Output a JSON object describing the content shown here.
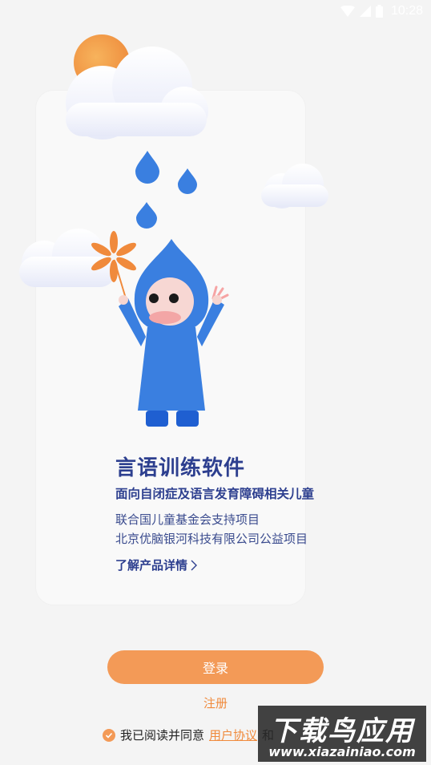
{
  "status_bar": {
    "time": "10:28"
  },
  "card": {
    "title": "言语训练软件",
    "subtitle": "面向自闭症及语言发育障碍相关儿童",
    "support_line1": "联合国儿童基金会支持项目",
    "support_line2": "北京优脑银河科技有限公司公益项目",
    "detail_link": "了解产品详情",
    "detail_icon": "chevron-right-icon"
  },
  "actions": {
    "login_label": "登录",
    "register_label": "注册"
  },
  "agreement": {
    "checked": true,
    "prefix": "我已阅读并同意",
    "user_agreement": "用户协议",
    "suffix": "和"
  },
  "watermark": {
    "title": "下载鸟应用",
    "url": "www.xiazainiao.com"
  },
  "colors": {
    "accent": "#f39a57",
    "title_blue": "#2d3f8f",
    "raincoat_blue": "#3a7fe0"
  }
}
